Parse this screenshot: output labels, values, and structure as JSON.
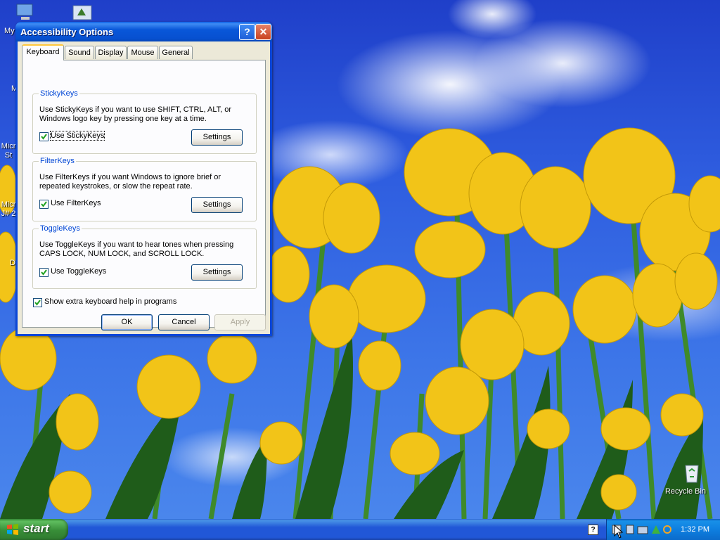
{
  "desktop": {
    "icons": [
      {
        "label": "My"
      },
      {
        "label": "My"
      },
      {
        "label": "Micr St"
      },
      {
        "label": "Micr J# 2"
      },
      {
        "label": "D"
      },
      {
        "label": "Recycle Bin"
      }
    ]
  },
  "dialog": {
    "title": "Accessibility Options",
    "help_button": "?",
    "close_button": "✕",
    "tabs": [
      {
        "label": "Keyboard",
        "active": true
      },
      {
        "label": "Sound"
      },
      {
        "label": "Display"
      },
      {
        "label": "Mouse"
      },
      {
        "label": "General"
      }
    ],
    "stickykeys": {
      "legend": "StickyKeys",
      "description": "Use StickyKeys if you want to use SHIFT, CTRL, ALT, or Windows logo key by pressing one key at a time.",
      "checkbox_label": "Use StickyKeys",
      "checked": true,
      "settings_label": "Settings"
    },
    "filterkeys": {
      "legend": "FilterKeys",
      "description": "Use FilterKeys if you want Windows to ignore brief or repeated keystrokes, or slow the repeat rate.",
      "checkbox_label": "Use FilterKeys",
      "checked": true,
      "settings_label": "Settings"
    },
    "togglekeys": {
      "legend": "ToggleKeys",
      "description": "Use ToggleKeys if you want to hear tones when pressing CAPS LOCK, NUM LOCK, and SCROLL LOCK.",
      "checkbox_label": "Use ToggleKeys",
      "checked": true,
      "settings_label": "Settings"
    },
    "extra_help": {
      "label": "Show extra keyboard help in programs",
      "checked": true
    },
    "buttons": {
      "ok": "OK",
      "cancel": "Cancel",
      "apply": "Apply"
    }
  },
  "taskbar": {
    "start_label": "start",
    "help_icon": "?",
    "clock": "1:32 PM"
  },
  "colors": {
    "titlebar": "#0750d0",
    "legend_text": "#0046d5",
    "start_green": "#388e38",
    "taskbar_blue": "#2157d7"
  }
}
